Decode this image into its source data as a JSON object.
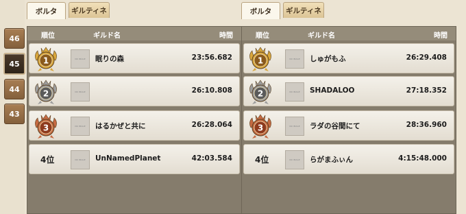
{
  "sidebar": {
    "weeks": [
      {
        "label": "46",
        "active": false
      },
      {
        "label": "45",
        "active": true
      },
      {
        "label": "44",
        "active": false
      },
      {
        "label": "43",
        "active": false
      }
    ]
  },
  "left_panel": {
    "tabs": [
      {
        "label": "ボルタ",
        "active": true
      },
      {
        "label": "ギルティネ",
        "active": false
      }
    ],
    "header": {
      "rank": "順位",
      "name": "ギルド名",
      "time": "時間"
    },
    "rows": [
      {
        "rank": "1",
        "medal": "gold",
        "name": "眠りの森",
        "time": "23:56.682"
      },
      {
        "rank": "2",
        "medal": "silver",
        "name": "",
        "time": "26:10.808"
      },
      {
        "rank": "3",
        "medal": "bronze",
        "name": "はるかぜと共に",
        "time": "26:28.064"
      },
      {
        "rank": "4位",
        "medal": "none",
        "name": "UnNamedPlanet",
        "time": "42:03.584"
      }
    ]
  },
  "right_panel": {
    "tabs": [
      {
        "label": "ボルタ",
        "active": true
      },
      {
        "label": "ギルティネ",
        "active": false
      }
    ],
    "header": {
      "rank": "順位",
      "name": "ギルド名",
      "time": "時間"
    },
    "rows": [
      {
        "rank": "1",
        "medal": "gold",
        "name": "しゅがもふ",
        "time": "26:29.408"
      },
      {
        "rank": "2",
        "medal": "silver",
        "name": "SHADALOO",
        "time": "27:18.352"
      },
      {
        "rank": "3",
        "medal": "bronze",
        "name": "ラダの谷間にて",
        "time": "28:36.960"
      },
      {
        "rank": "4位",
        "medal": "none",
        "name": "らがまふぃん",
        "time": "4:15:48.000"
      }
    ]
  },
  "colors": {
    "gold": "#d8a63c",
    "silver": "#9c9c9c",
    "bronze": "#c56a42",
    "medal_center_gold": "#8a5a1c",
    "medal_center_silver": "#5a5a5a",
    "medal_center_bronze": "#8e3a1d"
  }
}
